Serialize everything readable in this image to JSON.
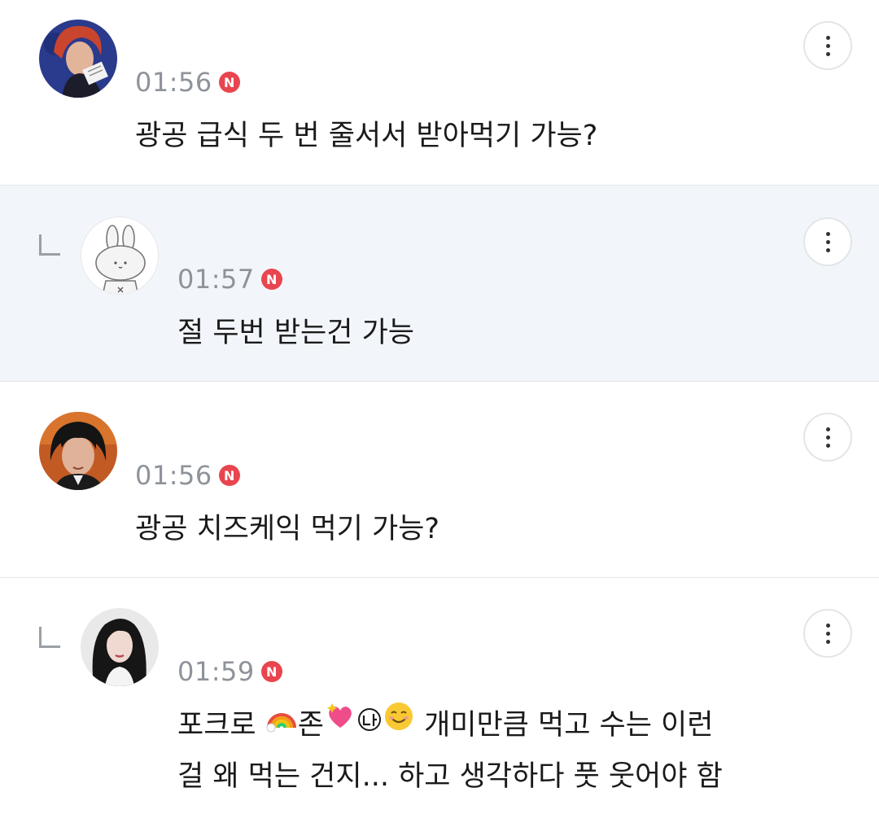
{
  "comments": [
    {
      "time": "01:56",
      "badge": "N",
      "text": "광공 급식 두 번 줄서서 받아먹기 가능?",
      "avatar": "avatar-red-hair",
      "reply": false
    },
    {
      "time": "01:57",
      "badge": "N",
      "text": "절 두번 받는건 가능",
      "avatar": "avatar-rabbit",
      "reply": true
    },
    {
      "time": "01:56",
      "badge": "N",
      "text": "광공 치즈케익 먹기 가능?",
      "avatar": "avatar-dark-hair",
      "reply": false
    },
    {
      "time": "01:59",
      "badge": "N",
      "text_part1": "포크로 ",
      "text_part2": "존",
      "text_part3": " 개미만큼 먹고 수는 이런",
      "text_line2": "걸 왜 먹는 건지... 하고 생각하다 풋 웃어야 함",
      "avatar": "avatar-woman",
      "reply": true
    }
  ],
  "icons": {
    "more": "more-vertical-icon",
    "reply": "reply-arrow-icon",
    "badge": "new-badge-icon",
    "emoji": [
      "rainbow-icon",
      "sparkling-heart-icon",
      "circled-na-icon",
      "smiling-face-icon"
    ]
  },
  "colors": {
    "reply_background": "#f2f6fb",
    "badge": "#e8454f",
    "time": "#8e939a",
    "text": "#1a1a1a"
  }
}
